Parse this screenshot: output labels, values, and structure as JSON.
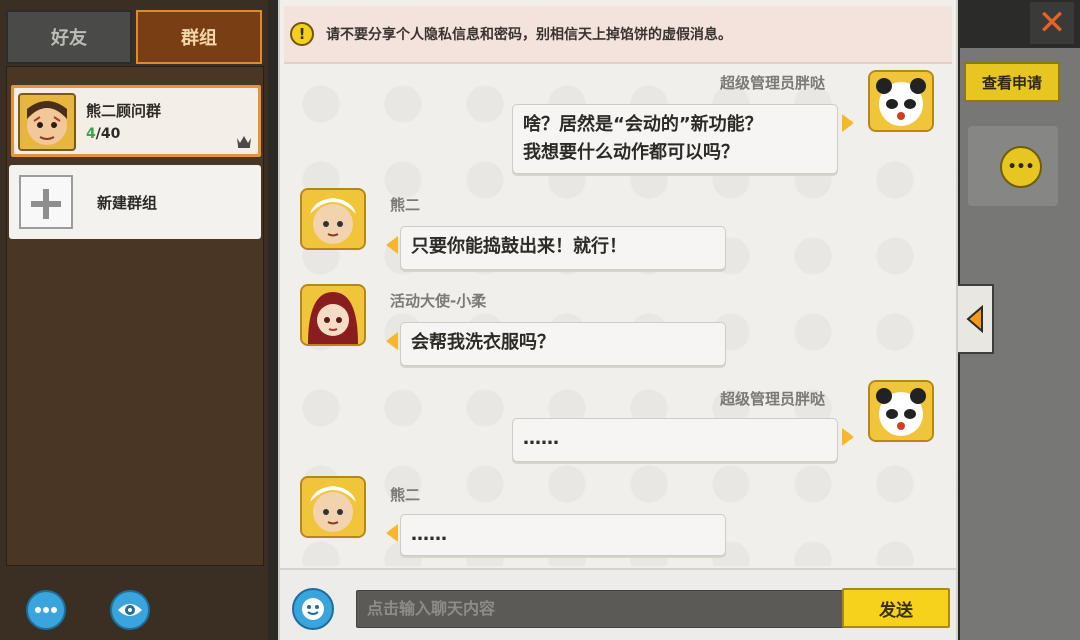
{
  "tabs": {
    "friends": "好友",
    "groups": "群组"
  },
  "group": {
    "name": "熊二顾问群",
    "online": "4",
    "total": "/40"
  },
  "new_group_label": "新建群组",
  "notice": "请不要分享个人隐私信息和密码，别相信天上掉馅饼的虚假消息。",
  "messages": [
    {
      "sender": "超级管理员胖哒",
      "line1": "啥？居然是“会动的”新功能？",
      "line2": "我想要什么动作都可以吗？",
      "side": "right"
    },
    {
      "sender": "熊二",
      "text": "只要你能捣鼓出来！就行！",
      "side": "left"
    },
    {
      "sender": "活动大使-小柔",
      "text": "会帮我洗衣服吗？",
      "side": "left"
    },
    {
      "sender": "超级管理员胖哒",
      "text": "……",
      "side": "right"
    },
    {
      "sender": "熊二",
      "text": "……",
      "side": "left"
    }
  ],
  "input": {
    "placeholder": "点击输入聊天内容",
    "send": "发送"
  },
  "right": {
    "review": "查看申请"
  },
  "colors": {
    "accent_orange": "#e89236",
    "accent_yellow": "#f6d21c",
    "bubble_arrow": "#f4b82a",
    "online_green": "#38a64a"
  }
}
